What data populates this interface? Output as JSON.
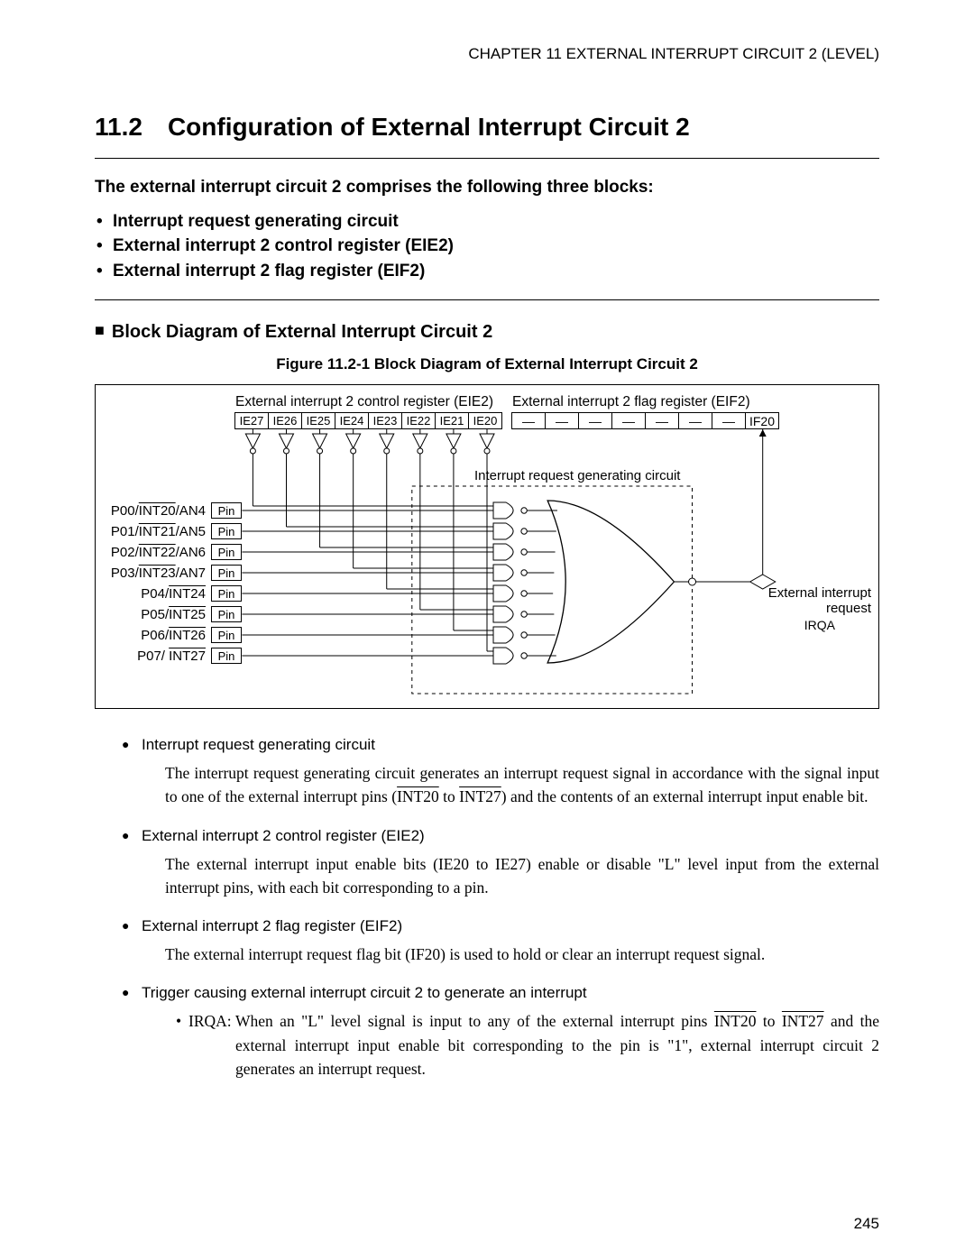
{
  "header": {
    "chapter": "CHAPTER 11  EXTERNAL INTERRUPT CIRCUIT 2 (LEVEL)"
  },
  "section": {
    "number": "11.2",
    "title": "Configuration of External Interrupt Circuit 2"
  },
  "intro": {
    "lead": "The external interrupt circuit 2 comprises the following three blocks:",
    "items": [
      "Interrupt request generating circuit",
      "External interrupt 2 control register (EIE2)",
      "External interrupt 2 flag register (EIF2)"
    ]
  },
  "subsection": {
    "title": "Block Diagram of External Interrupt Circuit 2"
  },
  "figure": {
    "caption": "Figure 11.2-1  Block Diagram of External Interrupt Circuit 2"
  },
  "diagram": {
    "eie2_label": "External interrupt 2 control register (EIE2)",
    "eif2_label": "External interrupt 2 flag register (EIF2)",
    "eie2_bits": [
      "IE27",
      "IE26",
      "IE25",
      "IE24",
      "IE23",
      "IE22",
      "IE21",
      "IE20"
    ],
    "eif2_bits": [
      "—",
      "—",
      "—",
      "—",
      "—",
      "—",
      "—",
      "IF20"
    ],
    "irq_gen_label": "Interrupt request generating circuit",
    "ext_req_label_1": "External interrupt",
    "ext_req_label_2": "request",
    "irqa": "IRQA",
    "pin_text": "Pin",
    "pins": [
      {
        "port": "P00/",
        "int": "INT20",
        "suffix": "/AN4"
      },
      {
        "port": "P01/",
        "int": "INT21",
        "suffix": "/AN5"
      },
      {
        "port": "P02/",
        "int": "INT22",
        "suffix": "/AN6"
      },
      {
        "port": "P03/",
        "int": "INT23",
        "suffix": "/AN7"
      },
      {
        "port": "P04/",
        "int": "INT24",
        "suffix": ""
      },
      {
        "port": "P05/",
        "int": "INT25",
        "suffix": ""
      },
      {
        "port": "P06/",
        "int": "INT26",
        "suffix": ""
      },
      {
        "port": "P07/ ",
        "int": "INT27",
        "suffix": ""
      }
    ]
  },
  "body": {
    "items": [
      {
        "head": "Interrupt request generating circuit",
        "body_pre": "The interrupt request generating circuit generates an interrupt request signal in accordance with the signal input to one of the external interrupt pins (",
        "int_a": "INT20",
        "mid": " to ",
        "int_b": "INT27",
        "body_post": ") and the contents of an external interrupt input enable bit."
      },
      {
        "head": "External interrupt 2 control register (EIE2)",
        "body": "The external interrupt input enable bits (IE20 to IE27) enable or disable \"L\" level input from the external interrupt pins, with each bit corresponding to a pin."
      },
      {
        "head": "External interrupt 2 flag register (EIF2)",
        "body": "The external interrupt request flag bit (IF20) is used to hold or clear an interrupt request signal."
      },
      {
        "head": "Trigger causing external interrupt circuit 2 to generate an interrupt",
        "sub": {
          "lead": "IRQA:",
          "pre": "When an \"L\" level signal is input to any of the external interrupt pins ",
          "int_a": "INT20",
          "mid": " to ",
          "int_b": "INT27",
          "post": " and the external interrupt input enable bit corresponding to the pin is \"1\", external interrupt circuit 2 generates an interrupt request."
        }
      }
    ]
  },
  "page": "245"
}
